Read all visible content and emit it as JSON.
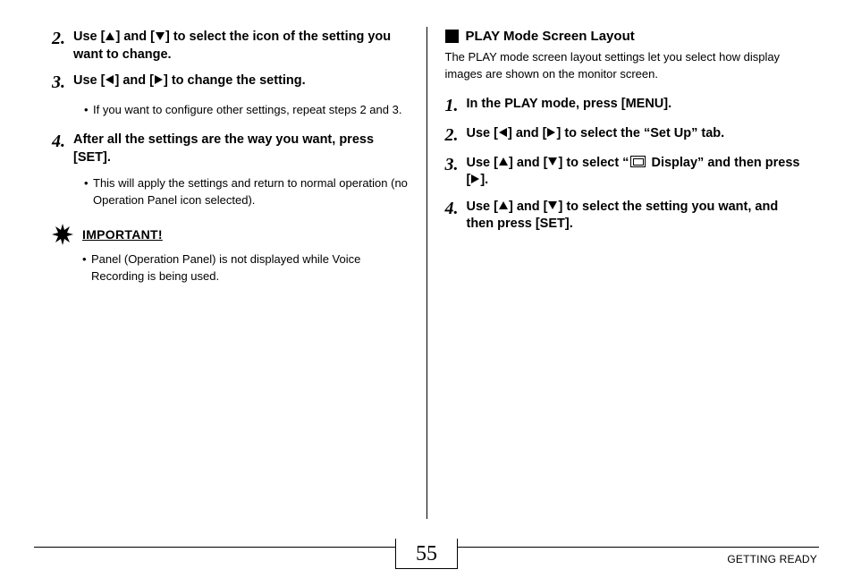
{
  "left": {
    "step2": {
      "num": "2.",
      "a": "Use [",
      "b": "] and [",
      "c": "] to select the icon of the setting you want to change."
    },
    "step3": {
      "num": "3.",
      "a": "Use [",
      "b": "] and [",
      "c": "] to change the setting."
    },
    "sub3": "If you want to configure other settings, repeat steps 2 and 3.",
    "step4": {
      "num": "4.",
      "t": "After all the settings are the way you want, press [SET]."
    },
    "sub4": "This will apply the settings and return to normal operation (no Operation Panel icon selected).",
    "important_label": "IMPORTANT!",
    "important_item": "Panel (Operation Panel) is not displayed while Voice Recording is being used."
  },
  "right": {
    "section_title": "PLAY Mode Screen Layout",
    "desc": "The PLAY mode screen layout settings let you select how display images are shown on the monitor screen.",
    "step1": {
      "num": "1.",
      "t": "In the PLAY mode, press [MENU]."
    },
    "step2": {
      "num": "2.",
      "a": "Use [",
      "b": "] and [",
      "c": "] to select the “Set Up” tab."
    },
    "step3": {
      "num": "3.",
      "a": "Use [",
      "b": "] and [",
      "c": "] to select “",
      "d": " Display” and then press [",
      "e": "]."
    },
    "step4": {
      "num": "4.",
      "a": "Use [",
      "b": "] and [",
      "c": "] to select the setting you want, and then press [SET]."
    }
  },
  "footer_text": "GETTING READY",
  "page_number": "55"
}
